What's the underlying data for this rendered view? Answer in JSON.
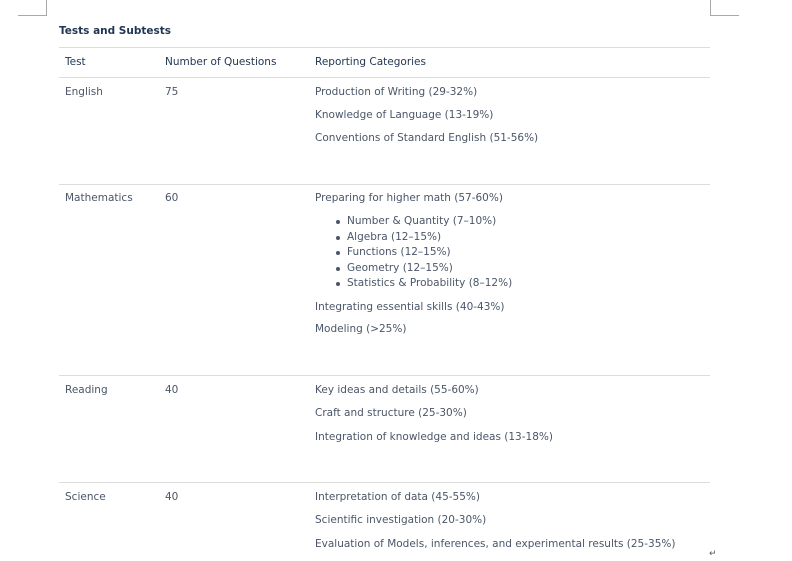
{
  "title": "Tests and Subtests",
  "headers": {
    "test": "Test",
    "questions": "Number of Questions",
    "categories": "Reporting Categories"
  },
  "rows": [
    {
      "test": "English",
      "questions": "75",
      "categories": [
        "Production of Writing (29-32%)",
        "Knowledge of Language (13-19%)",
        "Conventions of Standard English (51-56%)"
      ]
    },
    {
      "test": "Mathematics",
      "questions": "60",
      "categories": [
        "Preparing for higher math (57-60%)",
        "Integrating essential skills (40-43%)",
        "Modeling (>25%)"
      ],
      "subcategories": [
        "Number & Quantity (7–10%)",
        "Algebra (12–15%)",
        "Functions (12–15%)",
        "Geometry (12–15%)",
        "Statistics & Probability (8–12%)"
      ]
    },
    {
      "test": "Reading",
      "questions": "40",
      "categories": [
        "Key ideas and details (55-60%)",
        "Craft and structure (25-30%)",
        "Integration of knowledge and ideas (13-18%)"
      ]
    },
    {
      "test": "Science",
      "questions": "40",
      "categories": [
        "Interpretation of data (45-55%)",
        "Scientific investigation (20-30%)",
        "Evaluation of Models, inferences, and experimental results (25-35%)"
      ]
    }
  ],
  "paragraph_mark": "↵"
}
